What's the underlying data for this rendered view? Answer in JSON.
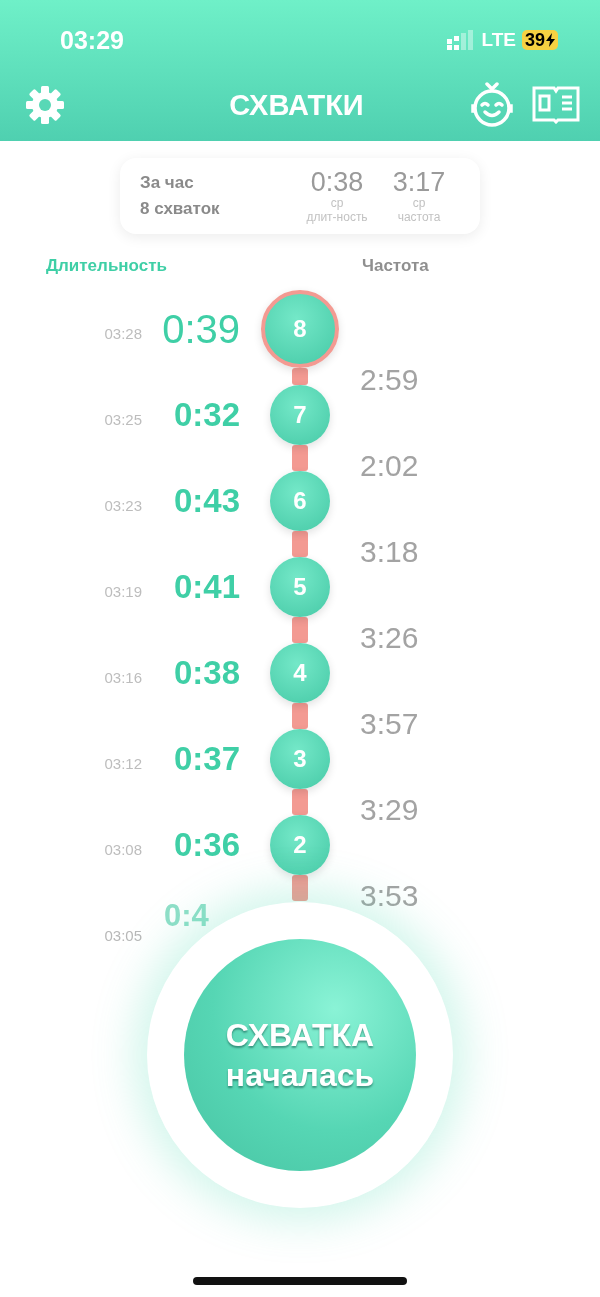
{
  "status_bar": {
    "time": "03:29",
    "network": "LTE",
    "battery": "39"
  },
  "header": {
    "title": "СХВАТКИ"
  },
  "summary": {
    "period": "За час",
    "count": "8 схваток",
    "stats": [
      {
        "value": "0:38",
        "prefix": "ср",
        "label": "длит-ность"
      },
      {
        "value": "3:17",
        "prefix": "ср",
        "label": "частота"
      }
    ]
  },
  "columns": [
    {
      "label": "Длительность",
      "selected": true
    },
    {
      "label": "Частота",
      "selected": false
    }
  ],
  "contractions": [
    {
      "kind": "current",
      "time": "03:28",
      "duration": "0:39",
      "number": "8",
      "interval": "2:59"
    },
    {
      "kind": "past",
      "time": "03:25",
      "duration": "0:32",
      "number": "7",
      "interval": "2:02"
    },
    {
      "kind": "past",
      "time": "03:23",
      "duration": "0:43",
      "number": "6",
      "interval": "3:18"
    },
    {
      "kind": "past",
      "time": "03:19",
      "duration": "0:41",
      "number": "5",
      "interval": "3:26"
    },
    {
      "kind": "past",
      "time": "03:16",
      "duration": "0:38",
      "number": "4",
      "interval": "3:57"
    },
    {
      "kind": "past",
      "time": "03:12",
      "duration": "0:37",
      "number": "3",
      "interval": "3:29"
    },
    {
      "kind": "past",
      "time": "03:08",
      "duration": "0:36",
      "number": "2",
      "interval": "3:53"
    },
    {
      "kind": "partial",
      "time": "03:05",
      "duration": "0:4"
    }
  ],
  "start_button": {
    "line1": "СХВАТКА",
    "line2": "началась"
  }
}
